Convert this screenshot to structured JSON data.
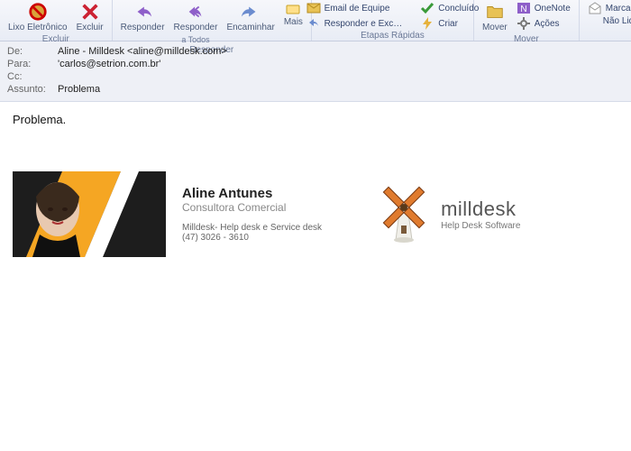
{
  "ribbon": {
    "groups": {
      "delete": {
        "caption": "Excluir",
        "junk": "Lixo Eletrônico",
        "delete": "Excluir"
      },
      "respond": {
        "caption": "Responder",
        "reply": "Responder",
        "reply_all": "Responder",
        "reply_all_sub": "a Todos",
        "forward": "Encaminhar",
        "more": "Mais"
      },
      "quick": {
        "caption": "Etapas Rápidas",
        "team_email": "Email de Equipe",
        "reply_delete": "Responder e Exc…",
        "done": "Concluído",
        "create": "Criar"
      },
      "move": {
        "caption": "Mover",
        "move": "Mover",
        "onenote": "OneNote",
        "actions": "Ações"
      },
      "tags": {
        "mark_read": "Marcar co",
        "mark_unread": "Não Lida"
      }
    }
  },
  "headers": {
    "from_label": "De:",
    "from_value": "Aline - Milldesk <aline@milldesk.com>",
    "to_label": "Para:",
    "to_value": "'carlos@setrion.com.br'",
    "cc_label": "Cc:",
    "cc_value": "",
    "subject_label": "Assunto:",
    "subject_value": "Problema"
  },
  "body": {
    "text": "Problema."
  },
  "signature": {
    "name": "Aline Antunes",
    "role": "Consultora Comercial",
    "company": "Milldesk- Help desk e Service desk",
    "phone": "(47) 3026 - 3610",
    "brand_name": "milldesk",
    "brand_tagline": "Help Desk Software"
  }
}
